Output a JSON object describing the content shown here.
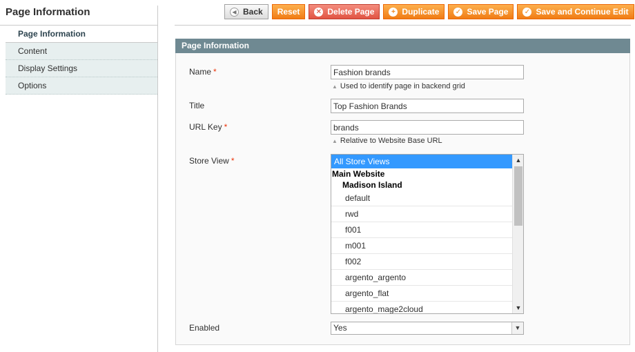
{
  "sidebar": {
    "title": "Page Information",
    "tabs": [
      {
        "label": "Page Information"
      },
      {
        "label": "Content"
      },
      {
        "label": "Display Settings"
      },
      {
        "label": "Options"
      }
    ]
  },
  "toolbar": {
    "back": "Back",
    "reset": "Reset",
    "delete": "Delete Page",
    "duplicate": "Duplicate",
    "save": "Save Page",
    "save_continue": "Save and Continue Edit"
  },
  "fieldset": {
    "title": "Page Information",
    "required_mark": "*",
    "name": {
      "label": "Name",
      "value": "Fashion brands",
      "note": "Used to identify page in backend grid"
    },
    "title_field": {
      "label": "Title",
      "value": "Top Fashion Brands"
    },
    "url_key": {
      "label": "URL Key",
      "value": "brands",
      "note": "Relative to Website Base URL"
    },
    "store_view": {
      "label": "Store View",
      "selected": "All Store Views",
      "group": "Main Website",
      "subgroup": "Madison Island",
      "options": [
        "default",
        "rwd",
        "f001",
        "m001",
        "f002",
        "argento_argento",
        "argento_flat",
        "argento_mage2cloud"
      ]
    },
    "enabled": {
      "label": "Enabled",
      "value": "Yes"
    }
  }
}
